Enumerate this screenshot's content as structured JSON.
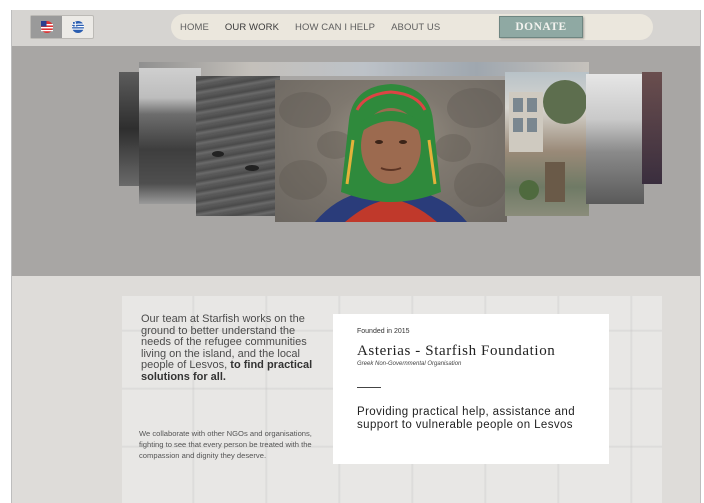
{
  "header": {
    "languages": [
      {
        "name": "us-flag-icon",
        "active": true
      },
      {
        "name": "greece-flag-icon",
        "active": false
      }
    ],
    "nav": [
      "HOME",
      "OUR WORK",
      "HOW CAN I HELP",
      "ABOUT US"
    ],
    "donate_label": "DONATE"
  },
  "hero": {
    "photos": [
      "coast-bw-photo",
      "rocks-bw-photo",
      "sea-bw-photo",
      "woman-portrait-photo",
      "street-color-photo",
      "doorway-bw-photo",
      "edge-color-photo"
    ]
  },
  "about": {
    "team_text": "Our team at Starfish works on the ground to better understand the needs of the refugee communities living on the island, and the local people of Lesvos,",
    "team_bold": "to find practical solutions for all.",
    "collab_text": "We collaborate with other NGOs and organisations, fighting to see that every person be treated with the compassion and dignity they deserve."
  },
  "card": {
    "founded": "Founded in 2015",
    "title": "Asterias - Starfish Foundation",
    "subtitle": "Greek Non-Governmental Organisation",
    "tagline": "Providing practical help, assistance and support to vulnerable people on Lesvos"
  },
  "colors": {
    "donate": "#8fa9a3",
    "hero_bg": "#a8a6a4",
    "scarf_green": "#2f8a3c"
  }
}
